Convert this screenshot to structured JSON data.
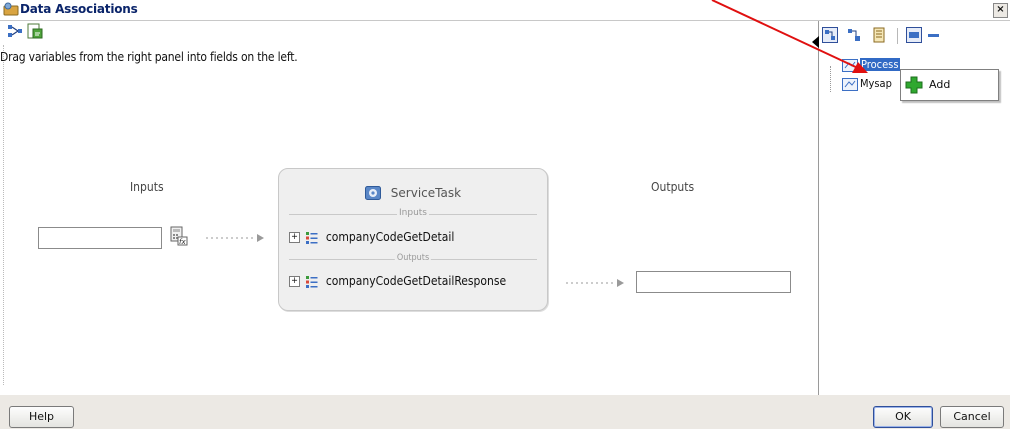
{
  "window": {
    "title": "Data Associations",
    "close_label": "×"
  },
  "instruction": "Drag variables from the right panel into fields on the left.",
  "left": {
    "inputs_label": "Inputs",
    "outputs_label": "Outputs",
    "input_field_value": "",
    "output_field_value": ""
  },
  "service": {
    "title": "ServiceTask",
    "inputs_section": "Inputs",
    "outputs_section": "Outputs",
    "input_item": "companyCodeGetDetail",
    "output_item": "companyCodeGetDetailResponse",
    "expander": "+"
  },
  "tree": {
    "items": [
      {
        "label": "Process",
        "selected": true
      },
      {
        "label": "Mysap"
      }
    ]
  },
  "context_menu": {
    "items": [
      {
        "label": "Add",
        "icon": "green-plus-icon"
      }
    ]
  },
  "footer": {
    "help_label": "Help",
    "ok_label": "OK",
    "cancel_label": "Cancel"
  },
  "colors": {
    "title_text": "#0a246a",
    "selection": "#316ac5",
    "arrow": "#e01010",
    "add_icon": "#2fa82f"
  }
}
